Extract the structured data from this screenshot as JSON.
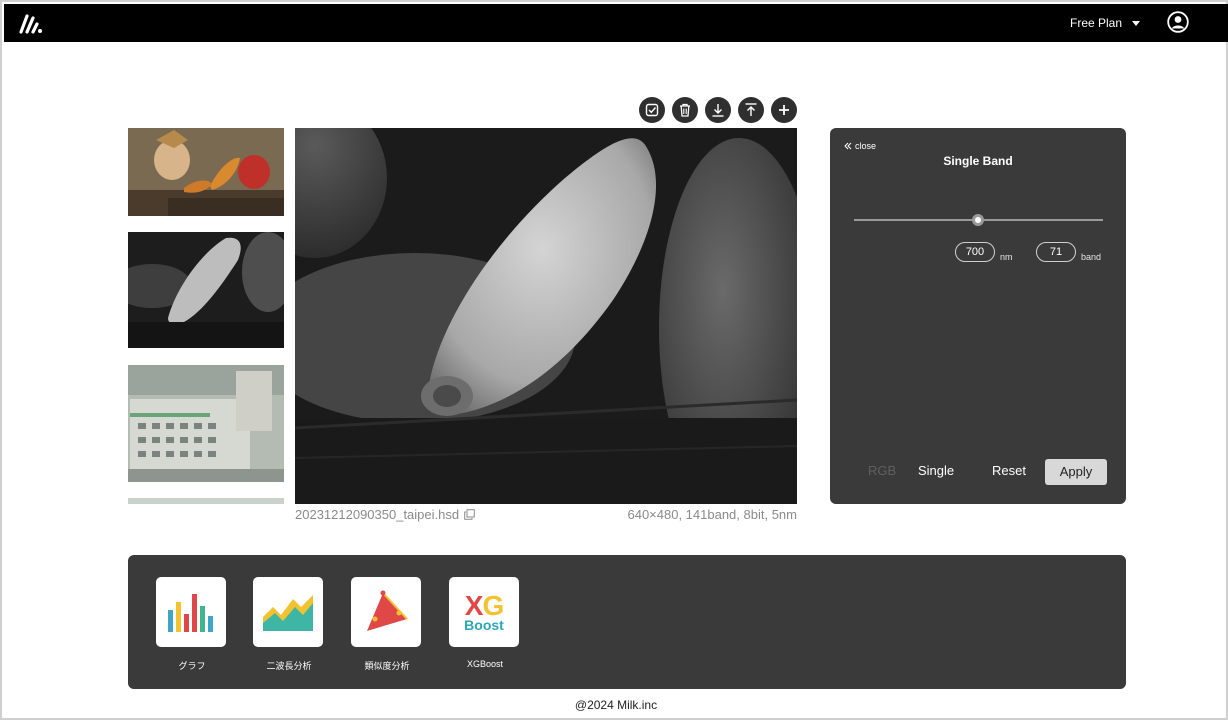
{
  "header": {
    "plan_label": "Free Plan"
  },
  "toolbar": {
    "buttons": [
      "check-square-icon",
      "trash-icon",
      "download-icon",
      "upload-icon",
      "plus-icon"
    ]
  },
  "viewer": {
    "filename": "20231212090350_taipei.hsd",
    "meta": "640×480, 141band, 8bit, 5nm"
  },
  "panel": {
    "close_label": "close",
    "title": "Single Band",
    "wavelength_value": "700",
    "wavelength_unit": "nm",
    "band_value": "71",
    "band_unit": "band",
    "slider_fraction": 0.5,
    "mode_rgb": "RGB",
    "mode_single": "Single",
    "reset_label": "Reset",
    "apply_label": "Apply"
  },
  "tools": [
    {
      "label": "グラフ",
      "icon": "bar-chart-icon"
    },
    {
      "label": "二波長分析",
      "icon": "mountain-chart-icon"
    },
    {
      "label": "類似度分析",
      "icon": "cone-icon"
    },
    {
      "label": "XGBoost",
      "icon": "xgboost-logo",
      "logo_top": "XG",
      "logo_bottom": "Boost"
    }
  ],
  "footer": {
    "copyright": "@2024 Milk.inc"
  }
}
